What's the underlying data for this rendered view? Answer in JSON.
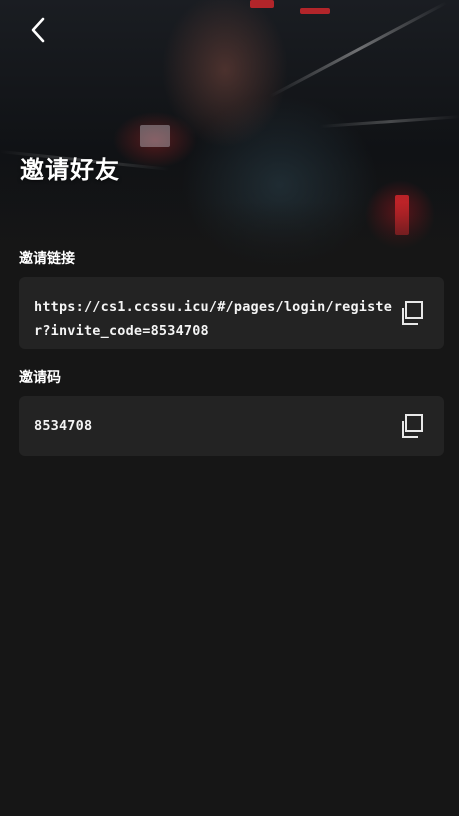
{
  "header": {
    "back_icon": "chevron-left-icon",
    "title": "邀请好友"
  },
  "invite_link": {
    "label": "邀请链接",
    "value": "https://cs1.ccssu.icu/#/pages/login/register?invite_code=8534708",
    "copy_icon": "copy-icon"
  },
  "invite_code": {
    "label": "邀请码",
    "value": "8534708",
    "copy_icon": "copy-icon"
  },
  "colors": {
    "background": "#161616",
    "card": "#232323",
    "text": "#ffffff",
    "accent_red": "#e6282d"
  }
}
